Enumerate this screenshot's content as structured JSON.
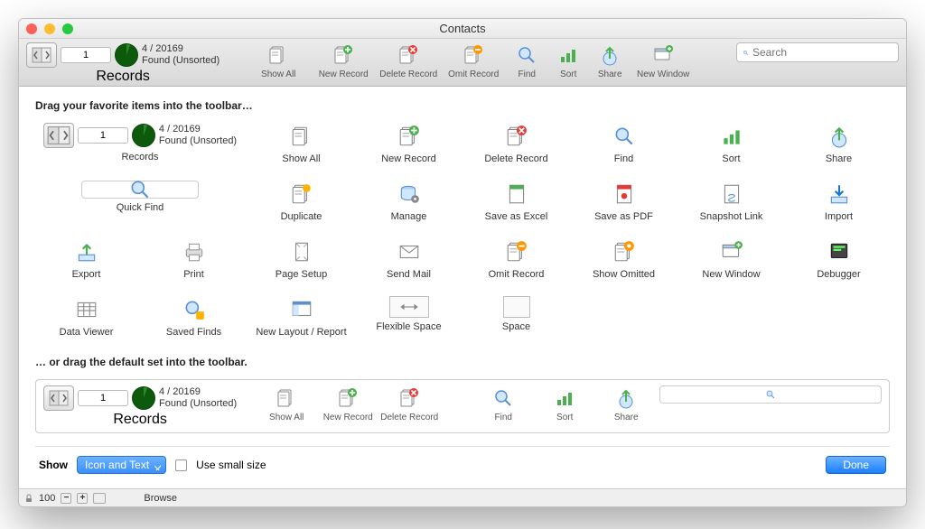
{
  "title": "Contacts",
  "records": {
    "current": "1",
    "found": "4 / 20169",
    "status": "Found (Unsorted)",
    "label": "Records"
  },
  "toolbar": {
    "show_all": "Show All",
    "new_record": "New Record",
    "delete_record": "Delete Record",
    "omit_record": "Omit Record",
    "find": "Find",
    "sort": "Sort",
    "share": "Share",
    "new_window": "New Window"
  },
  "search_placeholder": "Search",
  "panel": {
    "heading_favs": "Drag your favorite items into the toolbar…",
    "heading_default": "… or drag the default set into the toolbar."
  },
  "items": {
    "show_all": "Show All",
    "new_record": "New Record",
    "delete_record": "Delete Record",
    "find": "Find",
    "sort": "Sort",
    "share": "Share",
    "quick_find": "Quick Find",
    "duplicate": "Duplicate",
    "manage": "Manage",
    "save_excel": "Save as Excel",
    "save_pdf": "Save as PDF",
    "snapshot": "Snapshot Link",
    "import": "Import",
    "export": "Export",
    "print": "Print",
    "page_setup": "Page Setup",
    "send_mail": "Send Mail",
    "omit_record": "Omit Record",
    "show_omitted": "Show Omitted",
    "new_window": "New Window",
    "debugger": "Debugger",
    "data_viewer": "Data Viewer",
    "saved_finds": "Saved Finds",
    "new_layout": "New Layout / Report",
    "flexible_space": "Flexible Space",
    "space": "Space"
  },
  "bottom": {
    "show_label": "Show",
    "show_value": "Icon and Text",
    "small_size": "Use small size",
    "done": "Done"
  },
  "status": {
    "zoom": "100",
    "mode": "Browse"
  }
}
